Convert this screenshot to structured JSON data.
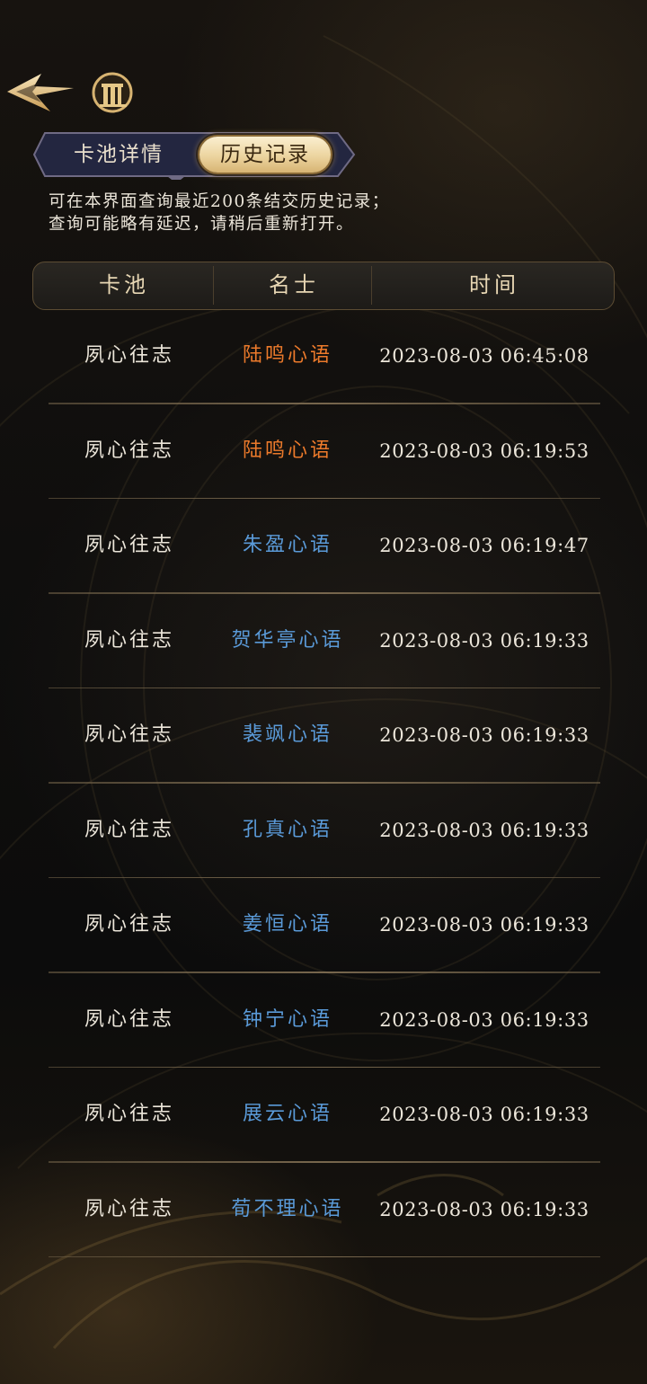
{
  "colors": {
    "gold_tier": "#ec7a2b",
    "blue_tier": "#5a9ad8",
    "text": "#ece6da",
    "header_text": "#e7d6b3"
  },
  "toolbar": {
    "back_icon": "arrow-back-icon",
    "emblem_icon": "gate-emblem-icon"
  },
  "tabs": [
    {
      "label": "卡池详情",
      "active": false
    },
    {
      "label": "历史记录",
      "active": true
    }
  ],
  "notice": {
    "line1": "可在本界面查询最近200条结交历史记录；",
    "line2": "查询可能略有延迟，请稍后重新打开。"
  },
  "table": {
    "headers": {
      "pool": "卡池",
      "name": "名士",
      "time": "时间"
    },
    "rows": [
      {
        "pool": "夙心往志",
        "name": "陆鸣心语",
        "time": "2023-08-03 06:45:08",
        "tier": "gold"
      },
      {
        "pool": "夙心往志",
        "name": "陆鸣心语",
        "time": "2023-08-03 06:19:53",
        "tier": "gold"
      },
      {
        "pool": "夙心往志",
        "name": "朱盈心语",
        "time": "2023-08-03 06:19:47",
        "tier": "blue"
      },
      {
        "pool": "夙心往志",
        "name": "贺华亭心语",
        "time": "2023-08-03 06:19:33",
        "tier": "blue"
      },
      {
        "pool": "夙心往志",
        "name": "裴飒心语",
        "time": "2023-08-03 06:19:33",
        "tier": "blue"
      },
      {
        "pool": "夙心往志",
        "name": "孔真心语",
        "time": "2023-08-03 06:19:33",
        "tier": "blue"
      },
      {
        "pool": "夙心往志",
        "name": "姜恒心语",
        "time": "2023-08-03 06:19:33",
        "tier": "blue"
      },
      {
        "pool": "夙心往志",
        "name": "钟宁心语",
        "time": "2023-08-03 06:19:33",
        "tier": "blue"
      },
      {
        "pool": "夙心往志",
        "name": "展云心语",
        "time": "2023-08-03 06:19:33",
        "tier": "blue"
      },
      {
        "pool": "夙心往志",
        "name": "荀不理心语",
        "time": "2023-08-03 06:19:33",
        "tier": "blue"
      }
    ]
  }
}
